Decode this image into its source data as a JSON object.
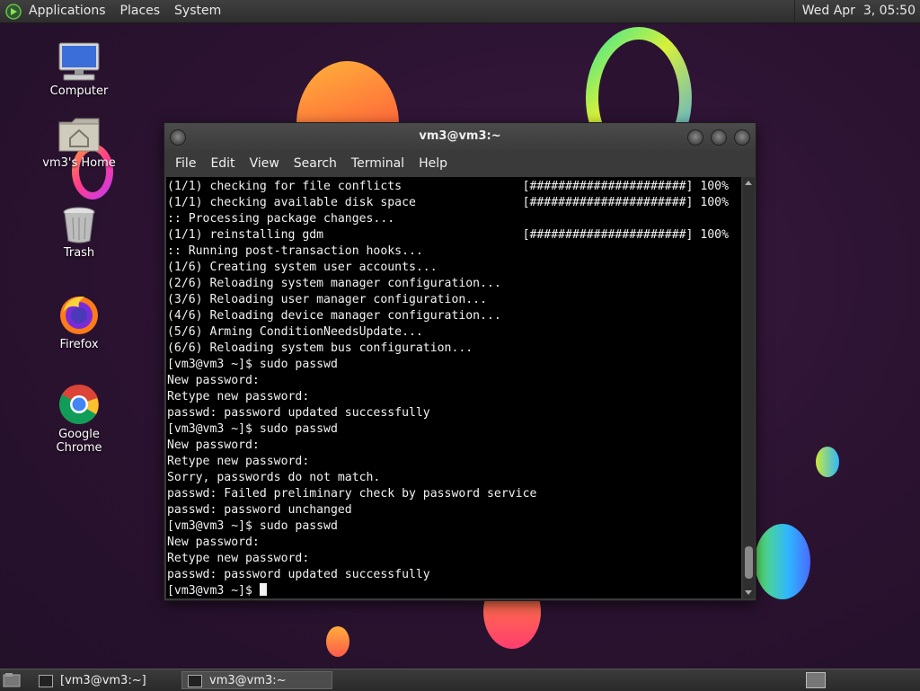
{
  "top_panel": {
    "menus": [
      "Applications",
      "Places",
      "System"
    ],
    "clock": "Wed Apr  3, 05:50"
  },
  "desktop_icons": [
    {
      "label": "Computer",
      "icon": "computer-icon"
    },
    {
      "label": "vm3's Home",
      "icon": "home-folder-icon"
    },
    {
      "label": "Trash",
      "icon": "trash-icon"
    },
    {
      "label": "Firefox",
      "icon": "firefox-icon"
    },
    {
      "label": "Google Chrome",
      "icon": "chrome-icon"
    }
  ],
  "terminal": {
    "title": "vm3@vm3:~",
    "menus": [
      "File",
      "Edit",
      "View",
      "Search",
      "Terminal",
      "Help"
    ],
    "lines": [
      "(1/1) checking for file conflicts                 [######################] 100%",
      "(1/1) checking available disk space               [######################] 100%",
      ":: Processing package changes...",
      "(1/1) reinstalling gdm                            [######################] 100%",
      ":: Running post-transaction hooks...",
      "(1/6) Creating system user accounts...",
      "(2/6) Reloading system manager configuration...",
      "(3/6) Reloading user manager configuration...",
      "(4/6) Reloading device manager configuration...",
      "(5/6) Arming ConditionNeedsUpdate...",
      "(6/6) Reloading system bus configuration...",
      "[vm3@vm3 ~]$ sudo passwd",
      "New password:",
      "Retype new password:",
      "passwd: password updated successfully",
      "[vm3@vm3 ~]$ sudo passwd",
      "New password:",
      "Retype new password:",
      "Sorry, passwords do not match.",
      "passwd: Failed preliminary check by password service",
      "passwd: password unchanged",
      "[vm3@vm3 ~]$ sudo passwd",
      "New password:",
      "Retype new password:",
      "passwd: password updated successfully",
      "[vm3@vm3 ~]$ "
    ]
  },
  "taskbar": {
    "tasks": [
      "[vm3@vm3:~]",
      "vm3@vm3:~"
    ]
  },
  "colors": {
    "desktop_bg": "#2a1230",
    "terminal_bg": "#000000",
    "terminal_fg": "#f2f2f2",
    "panel_bg": "#333333"
  }
}
